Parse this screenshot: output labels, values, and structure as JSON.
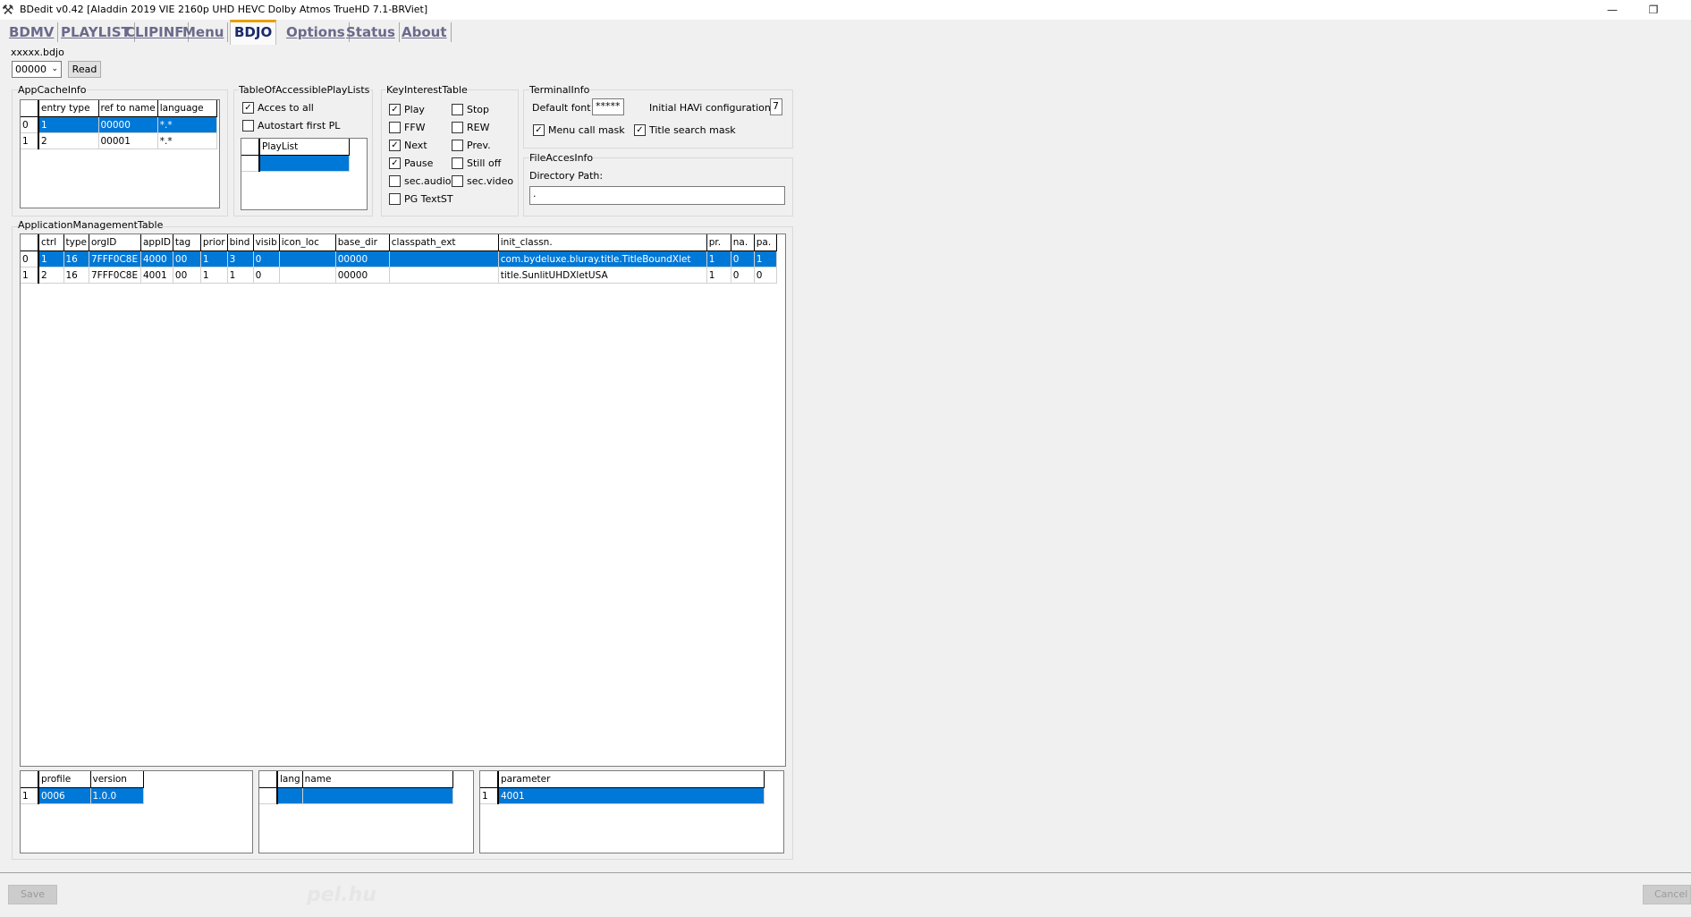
{
  "window": {
    "title": "BDedit v0.42 [Aladdin 2019 VIE 2160p UHD HEVC Dolby Atmos TrueHD 7.1-BRViet]",
    "minimize_glyph": "—",
    "restore_glyph": "❐"
  },
  "tabs": [
    "BDMV",
    "PLAYLIST",
    "CLIPINF",
    "Menu",
    "BDJO",
    "Options",
    "Status",
    "About"
  ],
  "active_tab": "BDJO",
  "file": {
    "name": "xxxxx.bdjo",
    "selector_value": "00000",
    "read_label": "Read"
  },
  "app_cache_info": {
    "title": "AppCacheInfo",
    "columns": [
      "entry type",
      "ref to name",
      "language"
    ],
    "rows": [
      {
        "idx": "0",
        "cells": [
          "1",
          "00000",
          "*.*"
        ],
        "selected": true
      },
      {
        "idx": "1",
        "cells": [
          "2",
          "00001",
          "*.*"
        ],
        "selected": false
      }
    ]
  },
  "accessible_playlists": {
    "title": "TableOfAccessiblePlayLists",
    "access_all": {
      "label": "Acces to all",
      "checked": true
    },
    "autostart": {
      "label": "Autostart first PL",
      "checked": false
    },
    "column": "PlayList"
  },
  "key_interest": {
    "title": "KeyInterestTable",
    "keys": [
      {
        "label": "Play",
        "checked": true
      },
      {
        "label": "Stop",
        "checked": false
      },
      {
        "label": "FFW",
        "checked": false
      },
      {
        "label": "REW",
        "checked": false
      },
      {
        "label": "Next",
        "checked": true
      },
      {
        "label": "Prev.",
        "checked": false
      },
      {
        "label": "Pause",
        "checked": true
      },
      {
        "label": "Still off",
        "checked": false
      },
      {
        "label": "sec.audio",
        "checked": false
      },
      {
        "label": "sec.video",
        "checked": false
      },
      {
        "label": "PG TextST",
        "checked": false
      }
    ]
  },
  "terminal_info": {
    "title": "TerminalInfo",
    "default_font_label": "Default font",
    "default_font_value": "*****",
    "havi_label": "Initial HAVi configuration id",
    "havi_value": "7",
    "menu_call_mask": {
      "label": "Menu call mask",
      "checked": true
    },
    "title_search_mask": {
      "label": "Title search mask",
      "checked": true
    }
  },
  "file_access_info": {
    "title": "FileAccesInfo",
    "dir_label": "Directory Path:",
    "dir_value": "."
  },
  "app_mgmt": {
    "title": "ApplicationManagementTable",
    "columns": [
      "ctrl",
      "type",
      "orgID",
      "appID",
      "tag",
      "prior",
      "bind",
      "visib",
      "icon_loc",
      "base_dir",
      "classpath_ext",
      "init_classn.",
      "pr.",
      "na.",
      "pa."
    ],
    "rows": [
      {
        "idx": "0",
        "cells": [
          "1",
          "16",
          "7FFF0C8E",
          "4000",
          "00",
          "1",
          "3",
          "0",
          "",
          "00000",
          "",
          "com.bydeluxe.bluray.title.TitleBoundXlet",
          "1",
          "0",
          "1"
        ],
        "selected": true
      },
      {
        "idx": "1",
        "cells": [
          "2",
          "16",
          "7FFF0C8E",
          "4001",
          "00",
          "1",
          "1",
          "0",
          "",
          "00000",
          "",
          "title.SunlitUHDXletUSA",
          "1",
          "0",
          "0"
        ],
        "selected": false
      }
    ]
  },
  "profile_table": {
    "columns": [
      "profile",
      "version"
    ],
    "rows": [
      {
        "idx": "1",
        "cells": [
          "0006",
          "1.0.0"
        ],
        "selected": true
      }
    ]
  },
  "name_table": {
    "columns": [
      "lang",
      "name"
    ]
  },
  "param_table": {
    "columns": [
      "parameter"
    ],
    "rows": [
      {
        "idx": "1",
        "cells": [
          "4001"
        ],
        "selected": true
      }
    ]
  },
  "footer": {
    "save_label": "Save",
    "cancel_label": "Cancel",
    "watermark": "pel.hu"
  }
}
